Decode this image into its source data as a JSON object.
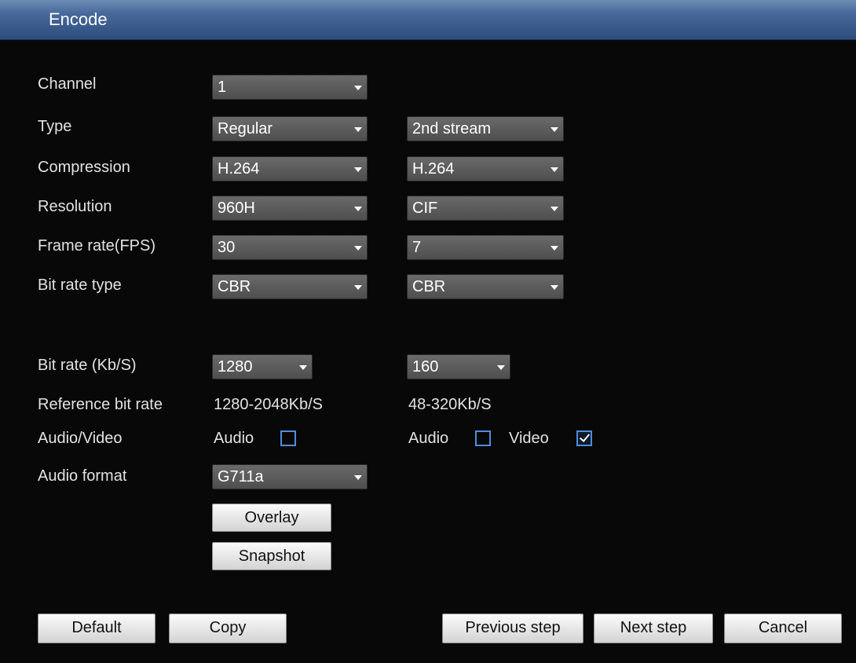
{
  "window": {
    "title": "Encode"
  },
  "form": {
    "channel": {
      "label": "Channel",
      "value": "1"
    },
    "type": {
      "label": "Type",
      "main": "Regular",
      "sub": "2nd stream"
    },
    "compression": {
      "label": "Compression",
      "main": "H.264",
      "sub": "H.264"
    },
    "resolution": {
      "label": "Resolution",
      "main": "960H",
      "sub": "CIF"
    },
    "frame_rate": {
      "label": "Frame rate(FPS)",
      "main": "30",
      "sub": "7"
    },
    "bit_rate_type": {
      "label": "Bit rate type",
      "main": "CBR",
      "sub": "CBR"
    },
    "bit_rate": {
      "label": "Bit rate (Kb/S)",
      "main": "1280",
      "sub": "160"
    },
    "reference_bit_rate": {
      "label": "Reference bit rate",
      "main": "1280-2048Kb/S",
      "sub": "48-320Kb/S"
    },
    "audio_video": {
      "label": "Audio/Video",
      "main_audio_label": "Audio",
      "main_audio_checked": false,
      "sub_audio_label": "Audio",
      "sub_audio_checked": false,
      "sub_video_label": "Video",
      "sub_video_checked": true
    },
    "audio_format": {
      "label": "Audio format",
      "value": "G711a"
    },
    "overlay_button": "Overlay",
    "snapshot_button": "Snapshot"
  },
  "footer": {
    "default": "Default",
    "copy": "Copy",
    "previous": "Previous step",
    "next": "Next step",
    "cancel": "Cancel"
  },
  "colors": {
    "titlebar": "#47689a",
    "background": "#000000",
    "checkbox": "#4d8de0"
  }
}
